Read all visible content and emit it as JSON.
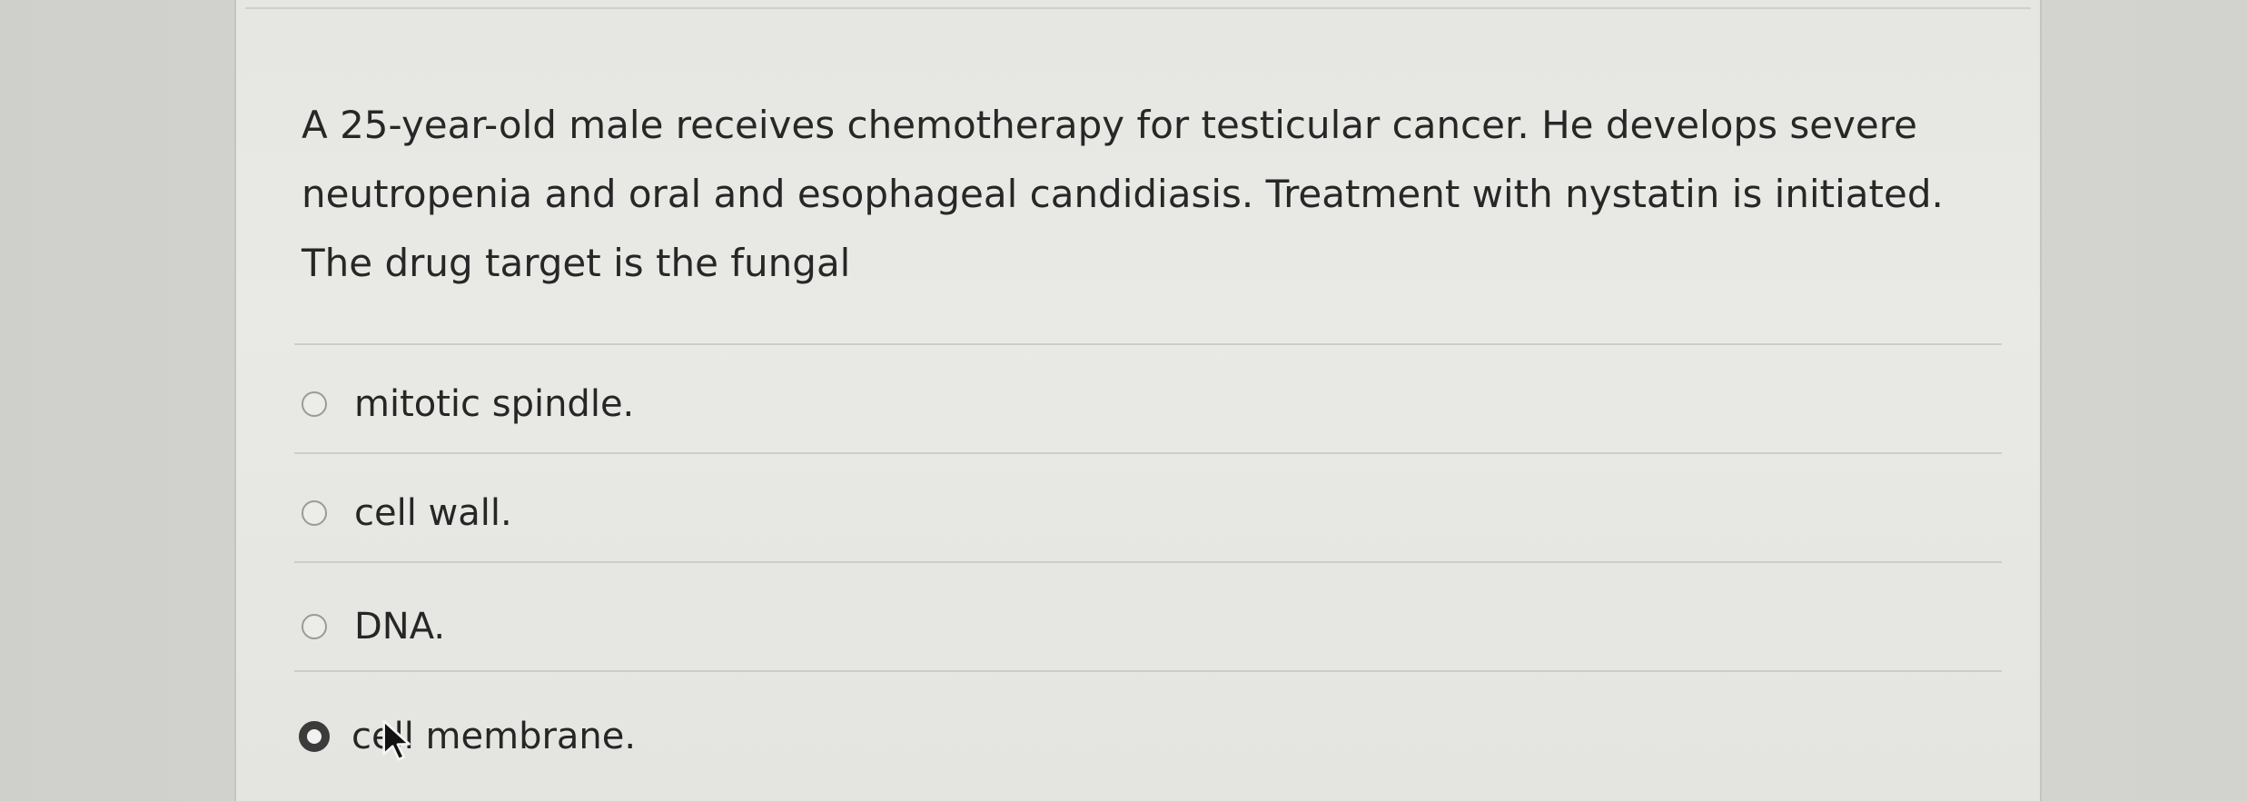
{
  "question": {
    "text": "A 25-year-old male receives chemotherapy for testicular cancer. He develops severe neutropenia and oral and esophageal candidiasis. Treatment with nystatin is initiated. The drug target is the fungal"
  },
  "options": [
    {
      "label": "mitotic spindle.",
      "selected": false
    },
    {
      "label": "cell wall.",
      "selected": false
    },
    {
      "label": "DNA.",
      "selected": false
    },
    {
      "label": "cell membrane.",
      "selected": true
    }
  ]
}
